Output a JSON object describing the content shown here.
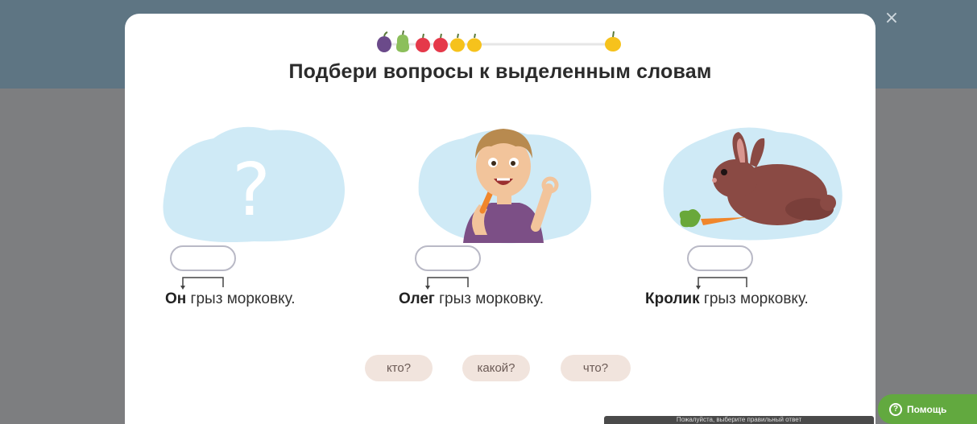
{
  "task": {
    "title": "Подбери вопросы к выделенным словам",
    "close_symbol": "×"
  },
  "progress": {
    "completed_icons": [
      "plum-icon",
      "pear-icon",
      "apple-icon",
      "apple-icon",
      "lemon-icon",
      "lemon-icon"
    ],
    "goal_icon": "lemon-icon"
  },
  "cards": [
    {
      "image": "question-mark",
      "highlight": "Он",
      "rest": " грыз морковку."
    },
    {
      "image": "boy-eating-carrot",
      "highlight": "Олег",
      "rest": " грыз морковку."
    },
    {
      "image": "rabbit-with-carrot",
      "highlight": "Кролик",
      "rest": " грыз морковку."
    }
  ],
  "answers": [
    {
      "label": "кто?"
    },
    {
      "label": "какой?"
    },
    {
      "label": "что?"
    }
  ],
  "help": {
    "label": "Помощь",
    "icon": "?"
  },
  "footer": {
    "text": "Пожалуйста, выберите правильный ответ"
  },
  "colors": {
    "cloud": "#cfeaf6",
    "slot_border": "#b9b9c6",
    "chip_bg": "#f1e4dd",
    "help_green": "#62a93f"
  }
}
